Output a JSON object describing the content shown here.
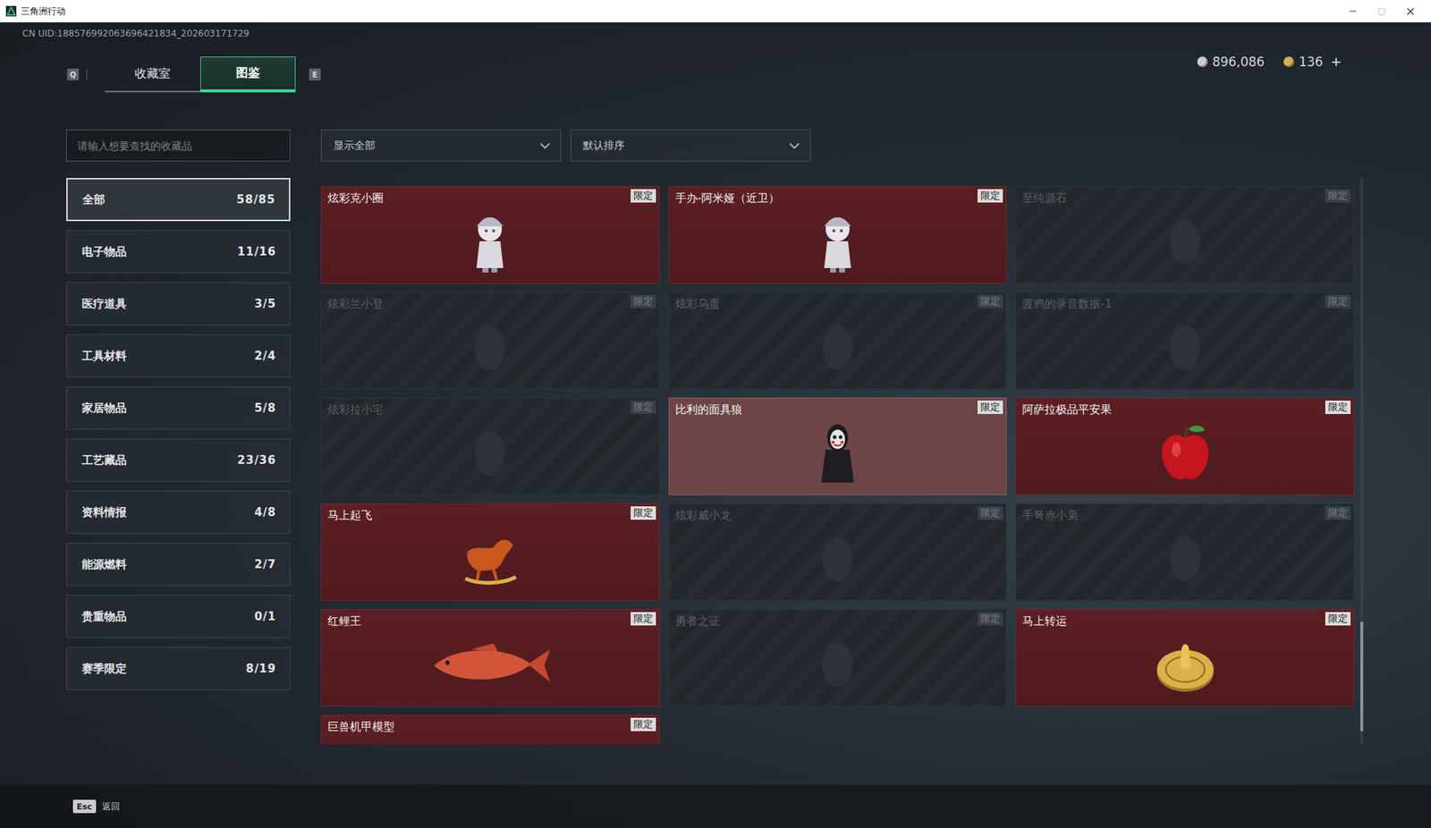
{
  "window": {
    "title": "三角洲行动"
  },
  "uid": "CN UID:188576992063696421834_202603171729",
  "tab_keys": {
    "prev": "Q",
    "next": "E"
  },
  "tabs": [
    {
      "label": "收藏室",
      "selected": false
    },
    {
      "label": "图鉴",
      "selected": true
    }
  ],
  "currency": [
    {
      "amount": "896,086",
      "color": "#c9ccd0",
      "add_button": ""
    },
    {
      "amount": "136",
      "color": "#d6b04a",
      "add_button": "+"
    }
  ],
  "search": {
    "placeholder": "请输入想要查找的收藏品"
  },
  "filters": [
    {
      "label": "显示全部"
    },
    {
      "label": "默认排序"
    }
  ],
  "sidebar": {
    "items": [
      {
        "label": "全部",
        "count": "58/85",
        "selected": true
      },
      {
        "label": "电子物品",
        "count": "11/16",
        "selected": false
      },
      {
        "label": "医疗道具",
        "count": "3/5",
        "selected": false
      },
      {
        "label": "工具材料",
        "count": "2/4",
        "selected": false
      },
      {
        "label": "家居物品",
        "count": "5/8",
        "selected": false
      },
      {
        "label": "工艺藏品",
        "count": "23/36",
        "selected": false
      },
      {
        "label": "资料情报",
        "count": "4/8",
        "selected": false
      },
      {
        "label": "能源燃料",
        "count": "2/7",
        "selected": false
      },
      {
        "label": "贵重物品",
        "count": "0/1",
        "selected": false
      },
      {
        "label": "赛季限定",
        "count": "8/19",
        "selected": false
      }
    ]
  },
  "grid": {
    "cards": [
      {
        "name": "炫彩克小圈",
        "badge": "限定",
        "collected": true,
        "highlighted": false
      },
      {
        "name": "手办-阿米娅（近卫）",
        "badge": "限定",
        "collected": true,
        "highlighted": false
      },
      {
        "name": "至纯源石",
        "badge": "限定",
        "collected": false,
        "highlighted": false
      },
      {
        "name": "炫彩兰小登",
        "badge": "限定",
        "collected": false,
        "highlighted": false
      },
      {
        "name": "炫彩乌蛋",
        "badge": "限定",
        "collected": false,
        "highlighted": false
      },
      {
        "name": "渡鸦的录音数据-1",
        "badge": "限定",
        "collected": false,
        "highlighted": false
      },
      {
        "name": "炫彩拉小宅",
        "badge": "限定",
        "collected": false,
        "highlighted": false
      },
      {
        "name": "比利的面具狼",
        "badge": "限定",
        "collected": true,
        "highlighted": true
      },
      {
        "name": "阿萨拉极品平安果",
        "badge": "限定",
        "collected": true,
        "highlighted": false
      },
      {
        "name": "马上起飞",
        "badge": "限定",
        "collected": true,
        "highlighted": false
      },
      {
        "name": "炫彩威小龙",
        "badge": "限定",
        "collected": false,
        "highlighted": false
      },
      {
        "name": "手弩赤小枭",
        "badge": "限定",
        "collected": false,
        "highlighted": false
      },
      {
        "name": "红鲤王",
        "badge": "限定",
        "collected": true,
        "highlighted": false
      },
      {
        "name": "勇者之证",
        "badge": "限定",
        "collected": false,
        "highlighted": false
      },
      {
        "name": "马上转运",
        "badge": "限定",
        "collected": true,
        "highlighted": false
      },
      {
        "name": "巨兽机甲模型",
        "badge": "限定",
        "collected": true,
        "highlighted": false
      }
    ]
  },
  "scrollbar": {
    "level": 0.97
  },
  "footer": {
    "key": "Esc",
    "label": "返回"
  }
}
